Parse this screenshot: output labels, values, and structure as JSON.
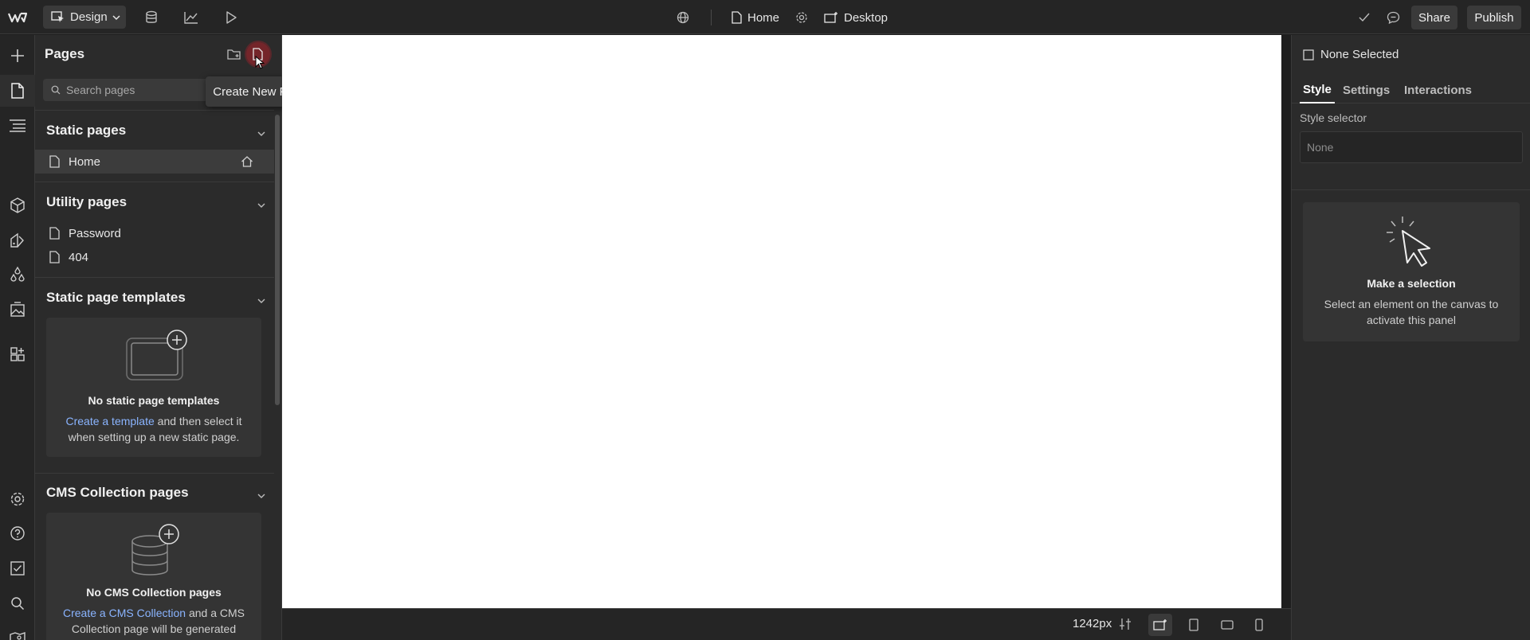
{
  "topbar": {
    "mode_label": "Design",
    "page_name": "Home",
    "breakpoint_label": "Desktop",
    "share_label": "Share",
    "publish_label": "Publish"
  },
  "pages_panel": {
    "title": "Pages",
    "search_placeholder": "Search pages",
    "tooltip": "Create New Page",
    "static_pages": {
      "title": "Static pages",
      "items": [
        {
          "label": "Home"
        }
      ]
    },
    "utility_pages": {
      "title": "Utility pages",
      "items": [
        {
          "label": "Password"
        },
        {
          "label": "404"
        }
      ]
    },
    "templates": {
      "title": "Static page templates",
      "empty_title": "No static page templates",
      "link": "Create a template",
      "desc_1": " and then select it",
      "desc_2": "when setting up a new static page."
    },
    "cms": {
      "title": "CMS Collection pages",
      "empty_title": "No CMS Collection pages",
      "link": "Create a CMS Collection",
      "desc_1": " and a CMS",
      "desc_2": "Collection page will be generated"
    }
  },
  "right_panel": {
    "none_selected": "None Selected",
    "tabs": [
      {
        "label": "Style"
      },
      {
        "label": "Settings"
      },
      {
        "label": "Interactions"
      }
    ],
    "style_selector_label": "Style selector",
    "style_selector_value": "None",
    "empty_title": "Make a selection",
    "empty_desc_1": "Select an element on the canvas to",
    "empty_desc_2": "activate this panel"
  },
  "bottombar": {
    "width_value": "1242px"
  },
  "colors": {
    "accent_link": "#8ab4ff",
    "cursor_highlight": "#b0202a"
  }
}
